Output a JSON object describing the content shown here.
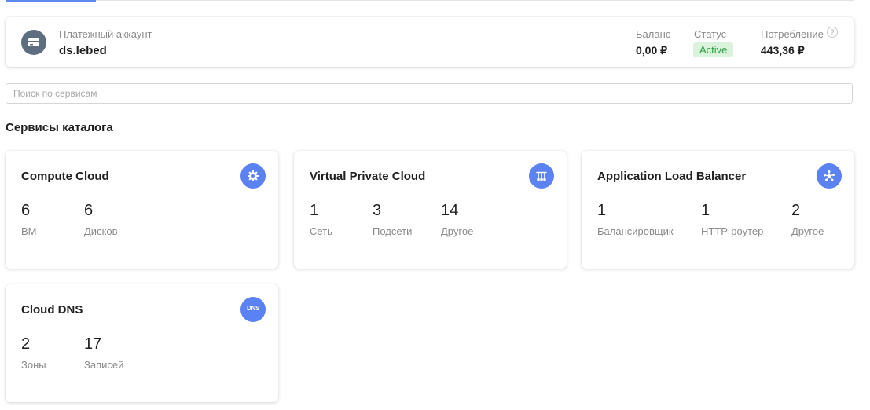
{
  "account": {
    "label": "Платежный аккаунт",
    "name": "ds.lebed",
    "balance_label": "Баланс",
    "balance_value": "0,00 ₽",
    "status_label": "Статус",
    "status_value": "Active",
    "consumption_label": "Потребление",
    "consumption_value": "443,36 ₽",
    "help_glyph": "?",
    "icon": "credit-card-icon"
  },
  "search": {
    "placeholder": "Поиск по сервисам"
  },
  "section_title": "Сервисы каталога",
  "cards": [
    {
      "title": "Compute Cloud",
      "icon": "compute-gear-icon",
      "stats": [
        {
          "value": "6",
          "label": "ВМ"
        },
        {
          "value": "6",
          "label": "Дисков"
        }
      ]
    },
    {
      "title": "Virtual Private Cloud",
      "icon": "network-icon",
      "stats": [
        {
          "value": "1",
          "label": "Сеть"
        },
        {
          "value": "3",
          "label": "Подсети"
        },
        {
          "value": "14",
          "label": "Другое"
        }
      ]
    },
    {
      "title": "Application Load Balancer",
      "icon": "load-balancer-icon",
      "stats": [
        {
          "value": "1",
          "label": "Балансировщик"
        },
        {
          "value": "1",
          "label": "HTTP-роутер"
        },
        {
          "value": "2",
          "label": "Другое"
        }
      ]
    },
    {
      "title": "Cloud DNS",
      "icon": "dns-icon",
      "icon_text": "DNS",
      "stats": [
        {
          "value": "2",
          "label": "Зоны"
        },
        {
          "value": "17",
          "label": "Записей"
        }
      ]
    }
  ],
  "colors": {
    "accent": "#5b82f2",
    "status_bg": "#dbf3dd",
    "status_text": "#2e9e3f",
    "account_icon_bg": "#5e6e80"
  }
}
